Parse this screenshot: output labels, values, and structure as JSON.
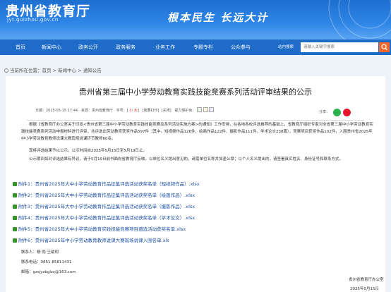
{
  "header": {
    "site_name": "贵州省教育厅",
    "site_domain": "jyt.guizhou.gov.cn",
    "slogan": "根本民生  长远大计"
  },
  "nav": {
    "items": [
      "首页",
      "新闻中心",
      "政务公开",
      "政务服务",
      "业务工作",
      "专题专栏",
      "公众参与"
    ],
    "search_label": "站内搜索",
    "search_placeholder": "请输入关键字搜索"
  },
  "breadcrumb": {
    "prefix": "当前所在位置：",
    "home": "首页",
    "sep1": ">",
    "news": "新闻中心",
    "sep2": ">",
    "notice": "通知公告"
  },
  "article": {
    "title": "贵州省第三届中小学劳动教育实践技能竞赛系列活动评审结果的公示",
    "meta_date": "日期：2025-05-15 17:44",
    "meta_source": "来源：贵州省教育厅",
    "meta_font_prefix": "字号：[",
    "meta_font_small": "小",
    "meta_font_large": "大",
    "meta_font_suffix": "]",
    "meta_print": "[我要打印]",
    "meta_close": "[关闭]",
    "meta_views": "视力保护色：",
    "share_label": "分享：",
    "para1": "根据《省教育厅办公室关于印发<贵州省第三届中小学劳动教育实践技能竞赛及系列活动实施方案>的通知》工作安排，在各地各校评选推荐的基础上，省教育厅组织专家对全省第三届中小学劳动教育实践技能竞赛系列活动申报材料进行评审，共评选出劳动教育获奖作品597件（其中，短视频作品126件、绘画作品122件、摄影作品111件、学术论文238篇），竞赛项目获奖作品102件，入围贵州省2025年中小学劳动教育教师说课大赛现场说课环节教师60名。",
    "para2": "现将评选结果予以公示。公示时间自2025年5月15日至5月19日止。",
    "para3": "公示期间如对评选结果有异议，请于5月19日前书面向省教育厅反映。以单位名义提出意见的，请需单位名称并加盖公章；以个人名义提出的，请签署真实姓名、身份证号和联系方式。",
    "attachments": [
      "附件1：贵州省2025年大中小学劳动教育作品征集评选活动获奖名单（短视频作品）.xlsx",
      "附件2：贵州省2025年大中小学劳动教育作品征集评选活动获奖名单（绘画作品）.xlsx",
      "附件3：贵州省2025年大中小学劳动教育作品征集评选活动获奖名单（摄影作品）.xlsx",
      "附件4：贵州省2025年大中小学劳动教育作品征集评选活动获奖名单（学术论文）.xlsx",
      "附件5：贵州省2025年大中小学劳动教育实践技能竞赛项目遴选活动获奖名单.xlsx",
      "附件6：贵州省2025年中小学劳动教育教师说课大赛现场说课入围名单.xls"
    ],
    "contact_person": "联系人：杨  雨  王歆玥",
    "contact_phone": "联系电话：0851-85811431",
    "contact_email": "邮箱：gzsjyzbglzx@163.com",
    "sign_org": "贵州省教育厅办公室",
    "sign_date": "2025年5月15日"
  }
}
